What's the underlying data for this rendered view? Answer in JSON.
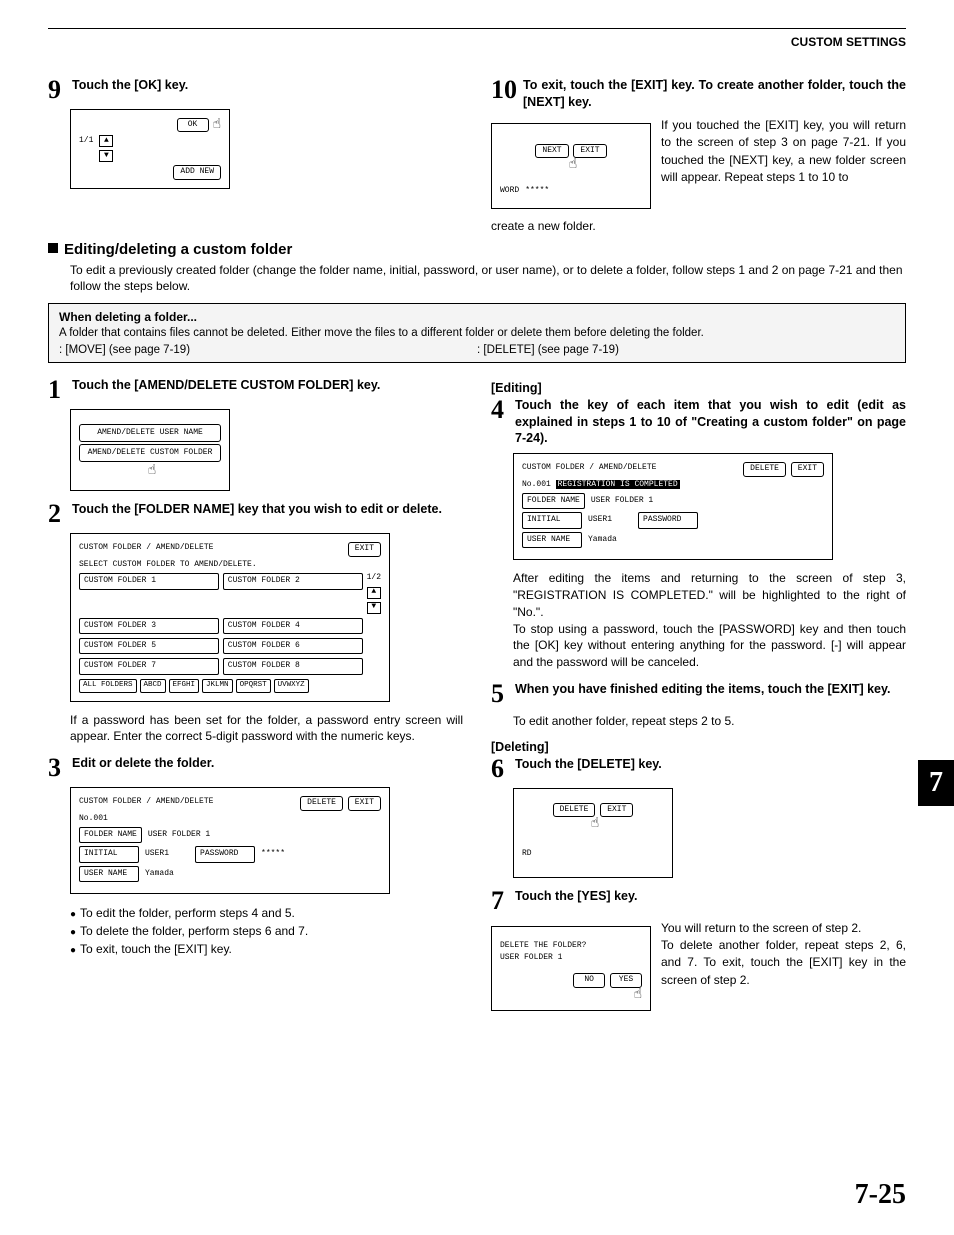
{
  "header": {
    "title": "CUSTOM SETTINGS"
  },
  "step9": {
    "num": "9",
    "text": "Touch the [OK] key.",
    "panel": {
      "ok": "OK",
      "page": "1/1",
      "add": "ADD NEW"
    }
  },
  "step10": {
    "num": "10",
    "text": "To exit, touch the [EXIT] key. To create another folder, touch the [NEXT] key.",
    "panel": {
      "next": "NEXT",
      "exit": "EXIT",
      "word": "WORD",
      "stars": "*****"
    },
    "caption": "create a new folder.",
    "desc": "If you touched the [EXIT] key, you will return to the screen of step 3 on page 7-21. If you touched the [NEXT] key, a new folder screen will appear. Repeat steps 1 to 10 to"
  },
  "section": {
    "heading": "Editing/deleting a custom folder",
    "intro": "To edit a previously created folder (change the folder name, initial, password, or user name), or to delete a folder, follow steps 1 and 2 on page 7-21 and then follow the steps below."
  },
  "note": {
    "title": "When deleting a folder...",
    "body": "A folder that contains files cannot be deleted. Either move the files to a different folder or delete them before deleting the folder.",
    "ref1": ": [MOVE] (see page 7-19)",
    "ref2": ": [DELETE] (see page 7-19)"
  },
  "step1": {
    "num": "1",
    "text": "Touch the [AMEND/DELETE CUSTOM FOLDER] key.",
    "panel": {
      "b1": "AMEND/DELETE USER NAME",
      "b2": "AMEND/DELETE CUSTOM FOLDER"
    }
  },
  "step2": {
    "num": "2",
    "text": "Touch the [FOLDER NAME] key that you wish to edit or delete.",
    "panel": {
      "title": "CUSTOM FOLDER / AMEND/DELETE",
      "exit": "EXIT",
      "instr": "SELECT CUSTOM FOLDER TO AMEND/DELETE.",
      "page": "1/2",
      "folders": [
        "CUSTOM FOLDER 1",
        "CUSTOM FOLDER 2",
        "CUSTOM FOLDER 3",
        "CUSTOM FOLDER 4",
        "CUSTOM FOLDER 5",
        "CUSTOM FOLDER 6",
        "CUSTOM FOLDER 7",
        "CUSTOM FOLDER 8"
      ],
      "tabs": [
        "ALL FOLDERS",
        "ABCD",
        "EFGHI",
        "JKLMN",
        "OPQRST",
        "UVWXYZ"
      ]
    },
    "desc": "If a password has been set for the folder, a password entry screen will appear. Enter the correct 5-digit password with the numeric keys."
  },
  "step3": {
    "num": "3",
    "text": "Edit or delete the folder.",
    "panel": {
      "title": "CUSTOM FOLDER / AMEND/DELETE",
      "delete": "DELETE",
      "exit": "EXIT",
      "no": "No.001",
      "fn_label": "FOLDER NAME",
      "fn_val": "USER FOLDER 1",
      "in_label": "INITIAL",
      "in_val": "USER1",
      "pw_label": "PASSWORD",
      "pw_val": "*****",
      "un_label": "USER NAME",
      "un_val": "Yamada"
    },
    "bullets": [
      "To edit the folder, perform steps 4 and 5.",
      "To delete the folder, perform steps 6 and 7.",
      "To exit, touch the [EXIT] key."
    ]
  },
  "editing_h": "[Editing]",
  "step4": {
    "num": "4",
    "text": "Touch the key of each item that you wish to edit (edit as explained in steps 1 to 10 of \"Creating a custom folder\" on page 7-24).",
    "panel": {
      "title": "CUSTOM FOLDER / AMEND/DELETE",
      "delete": "DELETE",
      "exit": "EXIT",
      "no": "No.001",
      "msg": "REGISTRATION IS COMPLETED",
      "fn_label": "FOLDER NAME",
      "fn_val": "USER FOLDER 1",
      "in_label": "INITIAL",
      "in_val": "USER1",
      "pw_label": "PASSWORD",
      "un_label": "USER NAME",
      "un_val": "Yamada"
    },
    "desc": "After editing the items and returning to the screen of step 3, \"REGISTRATION IS COMPLETED.\" will be highlighted to the right of \"No.\".\nTo stop using a password, touch the [PASSWORD] key and then touch the [OK] key without entering anything for the password. [-] will appear and the password will be canceled."
  },
  "step5": {
    "num": "5",
    "text": "When you have finished editing the items, touch the [EXIT] key.",
    "desc": "To edit another folder, repeat steps 2 to 5."
  },
  "deleting_h": "[Deleting]",
  "step6": {
    "num": "6",
    "text": "Touch the [DELETE] key.",
    "panel": {
      "delete": "DELETE",
      "exit": "EXIT",
      "rd": "RD"
    }
  },
  "step7": {
    "num": "7",
    "text": "Touch the [YES] key.",
    "panel": {
      "q": "DELETE THE FOLDER?",
      "name": "USER FOLDER 1",
      "no": "NO",
      "yes": "YES"
    },
    "desc": "You will return to the screen of step 2.\nTo delete another folder, repeat steps 2, 6, and 7. To exit, touch the [EXIT] key in the screen of step 2."
  },
  "chapter_tab": "7",
  "page_number": "7-25"
}
